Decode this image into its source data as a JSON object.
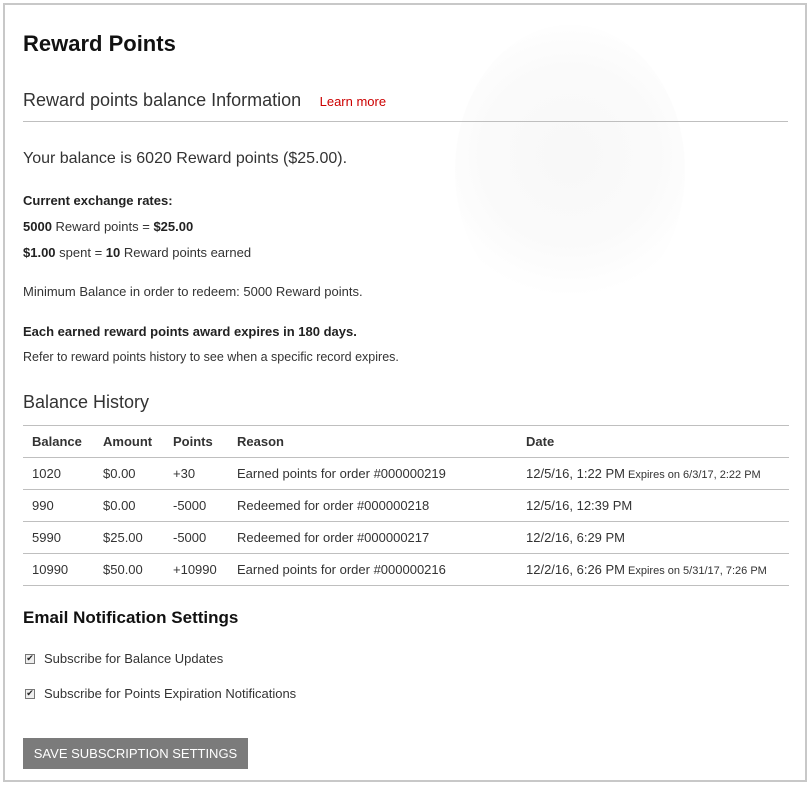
{
  "page": {
    "title": "Reward Points"
  },
  "balance_info": {
    "section_title": "Reward points balance Information",
    "learn_more": "Learn more",
    "balance_text": "Your balance is 6020 Reward points ($25.00).",
    "rates_label": "Current exchange rates:",
    "rate_redeem": {
      "points": "5000",
      "label": " Reward points = ",
      "value": "$25.00"
    },
    "rate_earn": {
      "spent": "$1.00",
      "label": " spent = ",
      "points": "10",
      "suffix": " Reward points earned"
    },
    "minimum_balance": "Minimum Balance in order to redeem: 5000 Reward points.",
    "expiry_notice": "Each earned reward points award expires in 180 days.",
    "expiry_refer": "Refer to reward points history to see when a specific record expires."
  },
  "history": {
    "title": "Balance History",
    "columns": [
      "Balance",
      "Amount",
      "Points",
      "Reason",
      "Date"
    ],
    "rows": [
      {
        "balance": "1020",
        "amount": "$0.00",
        "points": "+30",
        "reason": "Earned points for order #000000219",
        "date": "12/5/16, 1:22 PM",
        "expires": "Expires on 6/3/17, 2:22 PM"
      },
      {
        "balance": "990",
        "amount": "$0.00",
        "points": "-5000",
        "reason": "Redeemed for order #000000218",
        "date": "12/5/16, 12:39 PM",
        "expires": ""
      },
      {
        "balance": "5990",
        "amount": "$25.00",
        "points": "-5000",
        "reason": "Redeemed for order #000000217",
        "date": "12/2/16, 6:29 PM",
        "expires": ""
      },
      {
        "balance": "10990",
        "amount": "$50.00",
        "points": "+10990",
        "reason": "Earned points for order #000000216",
        "date": "12/2/16, 6:26 PM",
        "expires": "Expires on 5/31/17, 7:26 PM"
      }
    ]
  },
  "email": {
    "title": "Email Notification Settings",
    "balance_updates": {
      "label": "Subscribe for Balance Updates",
      "checked": true
    },
    "expiration_notifications": {
      "label": "Subscribe for Points Expiration Notifications",
      "checked": true
    },
    "save_button": "SAVE SUBSCRIPTION SETTINGS"
  },
  "colors": {
    "link": "#cc0000",
    "button_bg": "#7b7b7b",
    "border": "#bfbfbf"
  }
}
